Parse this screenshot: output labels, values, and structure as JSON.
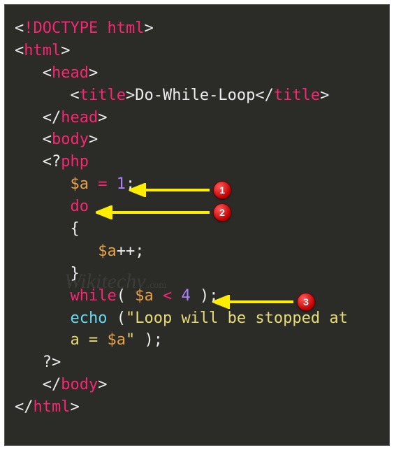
{
  "watermark": {
    "text": "Wikitechy",
    "suffix": ".com"
  },
  "badges": {
    "b1": "1",
    "b2": "2",
    "b3": "3"
  },
  "tokens": {
    "lt": "<",
    "gt": ">",
    "ltSlash": "</",
    "doctype": "!DOCTYPE html",
    "html": "html",
    "head": "head",
    "title": "title",
    "titleText": "Do-While-Loop",
    "body": "body",
    "phpOpen": "?",
    "phpWord": "php",
    "varA": "$a",
    "eq": " = ",
    "one": "1",
    "semi": ";",
    "do": "do",
    "lbrace": "{",
    "inc": "++;",
    "rbrace": "}",
    "while": "while",
    "lparen": "( ",
    "ltOp": " < ",
    "four": "4",
    "rparen": " );",
    "echo": "echo",
    "echoOpen": " (",
    "str1": "\"Loop will be stopped at ",
    "str2ind": "      ",
    "str2": "a = ",
    "varInStr": "$a",
    "strEnd": "\"",
    "echoClose": " );",
    "phpClose": "?>"
  }
}
